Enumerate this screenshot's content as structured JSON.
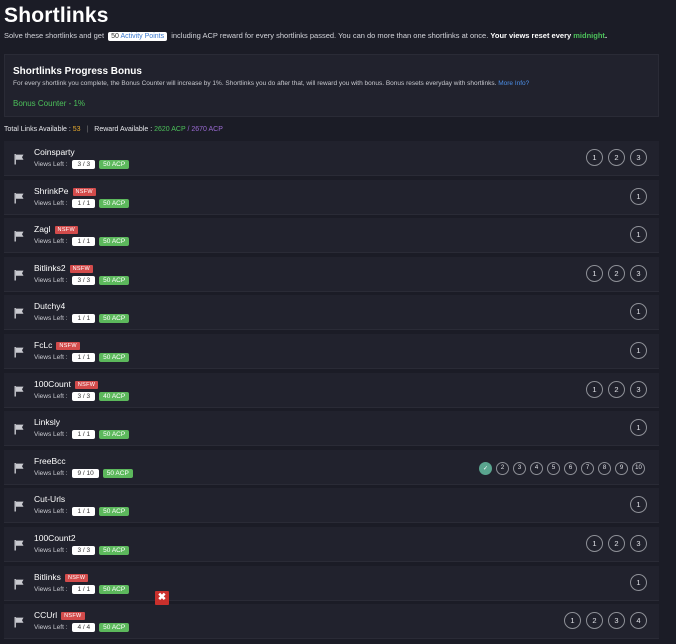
{
  "page": {
    "title": "Shortlinks",
    "intro": {
      "part1": "Solve these shortlinks and get",
      "points_value": "50",
      "points_label": "Activity Points",
      "part2": "including ACP reward for every shortlinks passed. You can do more than one shortlinks at once.",
      "reset_text": "Your views reset every",
      "reset_time": "midnight",
      "end": "."
    }
  },
  "bonus": {
    "title": "Shortlinks Progress Bonus",
    "description": "For every shortlink you complete, the Bonus Counter will increase by 1%. Shortlinks you do after that, will reward you with bonus. Bonus resets everyday with shortlinks.",
    "more_info": "More Info?",
    "counter": "Bonus Counter - 1%"
  },
  "stats": {
    "total_label": "Total Links Available :",
    "total_value": "53",
    "reward_label": "Reward Available :",
    "reward_value": "2620 ACP",
    "reward_sep": "/",
    "reward_total": "2670 ACP",
    "separator": "|"
  },
  "colors": {
    "background": "#1b1c26",
    "row": "#21222d",
    "nsfw": "#d24b4b",
    "acp_badge": "#5cb85c",
    "accent_green": "#4cc05a",
    "accent_purple": "#9a6ad3",
    "done": "#5aa58f"
  },
  "views_left_label": "Views Left :",
  "nsfw_label": "NSFW",
  "links": [
    {
      "name": "Coinsparty",
      "nsfw": false,
      "views": "3 / 3",
      "acp": "50 ACP",
      "circles": [
        "1",
        "2",
        "3"
      ]
    },
    {
      "name": "ShrinkPe",
      "nsfw": true,
      "views": "1 / 1",
      "acp": "50 ACP",
      "circles": [
        "1"
      ]
    },
    {
      "name": "Zagl",
      "nsfw": true,
      "views": "1 / 1",
      "acp": "50 ACP",
      "circles": [
        "1"
      ]
    },
    {
      "name": "Bitlinks2",
      "nsfw": true,
      "views": "3 / 3",
      "acp": "50 ACP",
      "circles": [
        "1",
        "2",
        "3"
      ]
    },
    {
      "name": "Dutchy4",
      "nsfw": false,
      "views": "1 / 1",
      "acp": "50 ACP",
      "circles": [
        "1"
      ]
    },
    {
      "name": "FcLc",
      "nsfw": true,
      "views": "1 / 1",
      "acp": "50 ACP",
      "circles": [
        "1"
      ]
    },
    {
      "name": "100Count",
      "nsfw": true,
      "views": "3 / 3",
      "acp": "40 ACP",
      "circles": [
        "1",
        "2",
        "3"
      ]
    },
    {
      "name": "Linksly",
      "nsfw": false,
      "views": "1 / 1",
      "acp": "50 ACP",
      "circles": [
        "1"
      ]
    },
    {
      "name": "FreeBcc",
      "nsfw": false,
      "views": "9 / 10",
      "acp": "50 ACP",
      "small": true,
      "done": 1,
      "circles": [
        "✓",
        "2",
        "3",
        "4",
        "5",
        "6",
        "7",
        "8",
        "9",
        "10"
      ]
    },
    {
      "name": "Cut-Urls",
      "nsfw": false,
      "views": "1 / 1",
      "acp": "50 ACP",
      "circles": [
        "1"
      ]
    },
    {
      "name": "100Count2",
      "nsfw": false,
      "views": "3 / 3",
      "acp": "50 ACP",
      "circles": [
        "1",
        "2",
        "3"
      ]
    },
    {
      "name": "Bitlinks",
      "nsfw": true,
      "views": "1 / 1",
      "acp": "50 ACP",
      "circles": [
        "1"
      ]
    },
    {
      "name": "CCUrl",
      "nsfw": true,
      "views": "4 / 4",
      "acp": "50 ACP",
      "circles": [
        "1",
        "2",
        "3",
        "4"
      ]
    }
  ],
  "close_button": {
    "icon": "close-icon",
    "glyph": "✖"
  }
}
